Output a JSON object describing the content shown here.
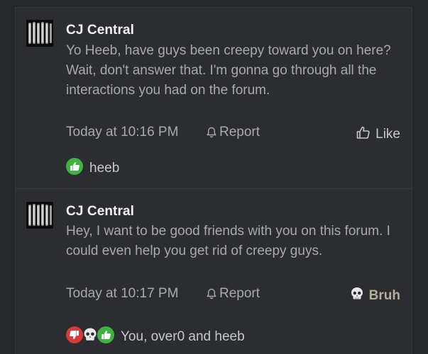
{
  "posts": [
    {
      "author": "CJ Central",
      "message": "Yo Heeb, have guys been creepy toward you on here? Wait, don't answer that. I'm gonna go through all the interactions you had on the forum.",
      "time": "Today at 10:16 PM",
      "report_label": "Report",
      "reaction_button_label": "Like",
      "reaction_button_icon": "thumbs-up-outline-icon",
      "reactions_icons": [
        "like-reaction-icon"
      ],
      "reactions_text": "heeb"
    },
    {
      "author": "CJ Central",
      "message": "Hey, I want to be good friends with you on this forum. I could even help you get rid of creepy guys.",
      "time": "Today at 10:17 PM",
      "report_label": "Report",
      "reaction_button_label": "Bruh",
      "reaction_button_icon": "skull-icon",
      "reactions_icons": [
        "dislike-reaction-icon",
        "skull-reaction-icon",
        "like-reaction-icon"
      ],
      "reactions_text": "You, over0 and heeb"
    }
  ],
  "colors": {
    "background": "#26272b",
    "panel": "#2c2d31",
    "username": "#f2f2f2",
    "message": "#a9a9ad",
    "like_green": "#3fb33f",
    "dislike_red": "#d83a3a",
    "bruh_text": "#b5ac99"
  }
}
